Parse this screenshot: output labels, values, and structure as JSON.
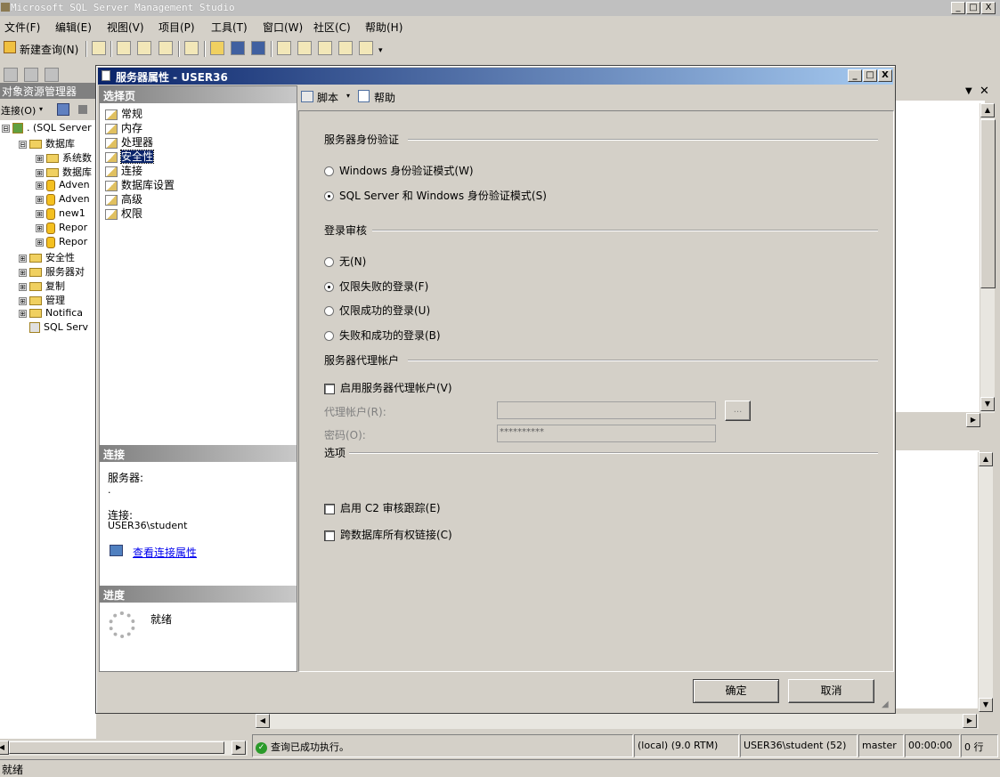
{
  "app": {
    "title": "Microsoft SQL Server Management Studio",
    "window_buttons": [
      "_",
      "□",
      "X"
    ]
  },
  "menu": [
    "文件(F)",
    "编辑(E)",
    "视图(V)",
    "项目(P)",
    "工具(T)",
    "窗口(W)",
    "社区(C)",
    "帮助(H)"
  ],
  "toolbar": {
    "new_query_label": "新建查询(N)"
  },
  "object_explorer": {
    "title": "对象资源管理器",
    "connect_label": "连接(O)",
    "tree": [
      {
        "label": ". (SQL Server",
        "level": 0,
        "expander": "⊟",
        "icon": "server-icon"
      },
      {
        "label": "数据库",
        "level": 1,
        "expander": "⊟",
        "icon": "folder-icon"
      },
      {
        "label": "系统数",
        "level": 2,
        "expander": "⊞",
        "icon": "folder-icon"
      },
      {
        "label": "数据库",
        "level": 2,
        "expander": "⊞",
        "icon": "folder-icon"
      },
      {
        "label": "Adven",
        "level": 2,
        "expander": "⊞",
        "icon": "database-icon"
      },
      {
        "label": "Adven",
        "level": 2,
        "expander": "⊞",
        "icon": "database-icon"
      },
      {
        "label": "new1",
        "level": 2,
        "expander": "⊞",
        "icon": "database-icon"
      },
      {
        "label": "Repor",
        "level": 2,
        "expander": "⊞",
        "icon": "database-icon"
      },
      {
        "label": "Repor",
        "level": 2,
        "expander": "⊞",
        "icon": "database-icon"
      },
      {
        "label": "安全性",
        "level": 1,
        "expander": "⊞",
        "icon": "folder-icon"
      },
      {
        "label": "服务器对",
        "level": 1,
        "expander": "⊞",
        "icon": "folder-icon"
      },
      {
        "label": "复制",
        "level": 1,
        "expander": "⊞",
        "icon": "folder-icon"
      },
      {
        "label": "管理",
        "level": 1,
        "expander": "⊞",
        "icon": "folder-icon"
      },
      {
        "label": "Notifica",
        "level": 1,
        "expander": "⊞",
        "icon": "folder-icon"
      },
      {
        "label": "SQL Serv",
        "level": 1,
        "expander": "",
        "icon": "agent-icon"
      }
    ]
  },
  "dialog": {
    "title": "服务器属性 - USER36",
    "select_page_header": "选择页",
    "pages": [
      "常规",
      "内存",
      "处理器",
      "安全性",
      "连接",
      "数据库设置",
      "高级",
      "权限"
    ],
    "selected_page": "安全性",
    "script_label": "脚本",
    "help_label": "帮助",
    "connection_header": "连接",
    "server_label": "服务器:",
    "server_value": ".",
    "connection_label": "连接:",
    "connection_value": "USER36\\student",
    "view_connection_link": "查看连接属性",
    "progress_header": "进度",
    "progress_status": "就绪",
    "auth_group": "服务器身份验证",
    "auth_windows": "Windows 身份验证模式(W)",
    "auth_mixed": "SQL Server 和 Windows 身份验证模式(S)",
    "auth_selected": "mixed",
    "audit_group": "登录审核",
    "audit_none": "无(N)",
    "audit_failed": "仅限失败的登录(F)",
    "audit_success": "仅限成功的登录(U)",
    "audit_both": "失败和成功的登录(B)",
    "audit_selected": "failed",
    "proxy_group": "服务器代理帐户",
    "proxy_enable": "启用服务器代理帐户(V)",
    "proxy_enabled": false,
    "proxy_account_label": "代理帐户(R):",
    "proxy_account_value": "",
    "proxy_browse": "...",
    "password_label": "密码(O):",
    "password_value": "**********",
    "options_group": "选项",
    "c2_audit": "启用 C2 审核跟踪(E)",
    "c2_checked": false,
    "cross_db": "跨数据库所有权链接(C)",
    "cross_db_checked": false,
    "ok_button": "确定",
    "cancel_button": "取消"
  },
  "query_status": {
    "message": "查询已成功执行。",
    "server": "(local) (9.0 RTM)",
    "user": "USER36\\student (52)",
    "database": "master",
    "elapsed": "00:00:00",
    "rows": "0 行"
  },
  "statusbar": {
    "text": "就绪"
  }
}
